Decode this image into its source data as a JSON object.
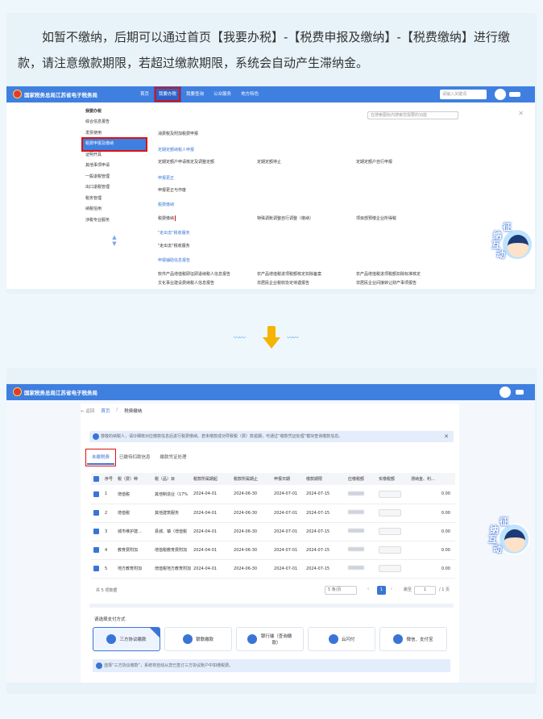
{
  "intro": {
    "text": "如暂不缴纳，后期可以通过首页【我要办税】-【税费申报及缴纳】-【税费缴纳】进行缴款，请注意缴款期限，若超过缴款期限，系统会自动产生滞纳金。"
  },
  "shot1": {
    "brand": "国家税务总局江苏省电子税务局",
    "nav": [
      "首页",
      "我要办税",
      "我要查询",
      "公众服务",
      "地方特色"
    ],
    "search_placeholder": "请输入关键词",
    "sidebar_title": "我要办税",
    "sidebar": [
      "综合信息报告",
      "发票使用",
      "税费申报及缴纳",
      "证明开具",
      "税收减免",
      "其他事项申请",
      "一般退税管理",
      "出口退税管理",
      "税务管理",
      "纳税信用",
      "涉税专业服务"
    ],
    "sidebar_title2": "我要办税",
    "menu_search_placeholder": "在搜索图标内搜索您需要的功能",
    "row1": [
      "消费税及附加税费申报"
    ],
    "cat1": "定期定额纳税人申报",
    "row2": [
      "定期定额户申请核定及调整定额",
      "定期定额停止",
      "定期定额户自行申报"
    ],
    "cat2": "申报更正",
    "row3": [
      "申报更正与作废"
    ],
    "cat3": "税费缴纳",
    "row4": [
      "税费缴纳",
      "特殊调账调整自行调整（缴纳）",
      "项目部预缴企业所得税"
    ],
    "cat4": "\"走出去\"税收服务",
    "row5": [
      "\"走出去\"税收服务"
    ],
    "cat5": "申报辅助信息报告",
    "row6": [
      "软件产品增值税即征即退纳税人信息报告",
      "农产品增值税进项税额核定扣除备案",
      "农产品增值税进项税额扣除标准核定"
    ],
    "row7": [
      "文化事业建设费纳税人信息报告",
      "非居民企业税收协定待遇报告",
      "非居民企业间接转让财产事项报告"
    ]
  },
  "mascot": {
    "chars": [
      "纳",
      "征",
      "互",
      "动"
    ]
  },
  "arrow": {
    "waves": "〰〰"
  },
  "shot2": {
    "brand": "国家税务总局江苏省电子税务局",
    "back": "← 返回",
    "crumb": [
      "首页",
      "税费缴纳"
    ],
    "notice": "尊敬的纳税人，请仔细核对应缴款信息后进行税费缴纳。若未缴款成功导致税（费）款逾期，可通过“缴款凭证处理”模块查询缴款信息。",
    "tabs": [
      "未缴税费",
      "已缴待扣款信息",
      "缴款凭证处理"
    ],
    "headers": [
      "序号",
      "税（费）种",
      "税（品）目",
      "税款所属期起",
      "税款所属期止",
      "申报日期",
      "缴款期限",
      "应缴税额",
      "实缴税额",
      "滞纳金、利..."
    ],
    "rows": [
      {
        "n": "1",
        "type": "增值税",
        "item": "其他制造业（17%",
        "start": "2024-04-01",
        "end": "2024-06-30",
        "decl": "2024-07-01",
        "due": "2024-07-15",
        "late": "0.00"
      },
      {
        "n": "2",
        "type": "增值税",
        "item": "其他建筑服务",
        "start": "2024-04-01",
        "end": "2024-06-30",
        "decl": "2024-07-01",
        "due": "2024-07-15",
        "late": "0.00"
      },
      {
        "n": "3",
        "type": "城市维护建...",
        "item": "县城、镇（增值税",
        "start": "2024-04-01",
        "end": "2024-06-30",
        "decl": "2024-07-01",
        "due": "2024-07-15",
        "late": "0.00"
      },
      {
        "n": "4",
        "type": "教育费附加",
        "item": "增值税教育费附加",
        "start": "2024-04-01",
        "end": "2024-06-30",
        "decl": "2024-07-01",
        "due": "2024-07-15",
        "late": "0.00"
      },
      {
        "n": "5",
        "type": "地方教育附加",
        "item": "增值税地方教育附加",
        "start": "2024-04-01",
        "end": "2024-06-30",
        "decl": "2024-07-01",
        "due": "2024-07-15",
        "late": "0.00"
      }
    ],
    "total": "共 5 项数据",
    "page_size": "5 条/页",
    "page": "1",
    "goto": "跳至",
    "goto_val": "1",
    "pages": "/ 1 页",
    "pay_label": "请选择支付方式",
    "pays": [
      "三方协议缴款",
      "银联缴款",
      "银行端（查询缴款）",
      "云闪付",
      "微信、支付宝"
    ],
    "tip": "选择“三方协议缴款”，系统将自动从您已签订三方协议账户中扣缴税费。"
  }
}
